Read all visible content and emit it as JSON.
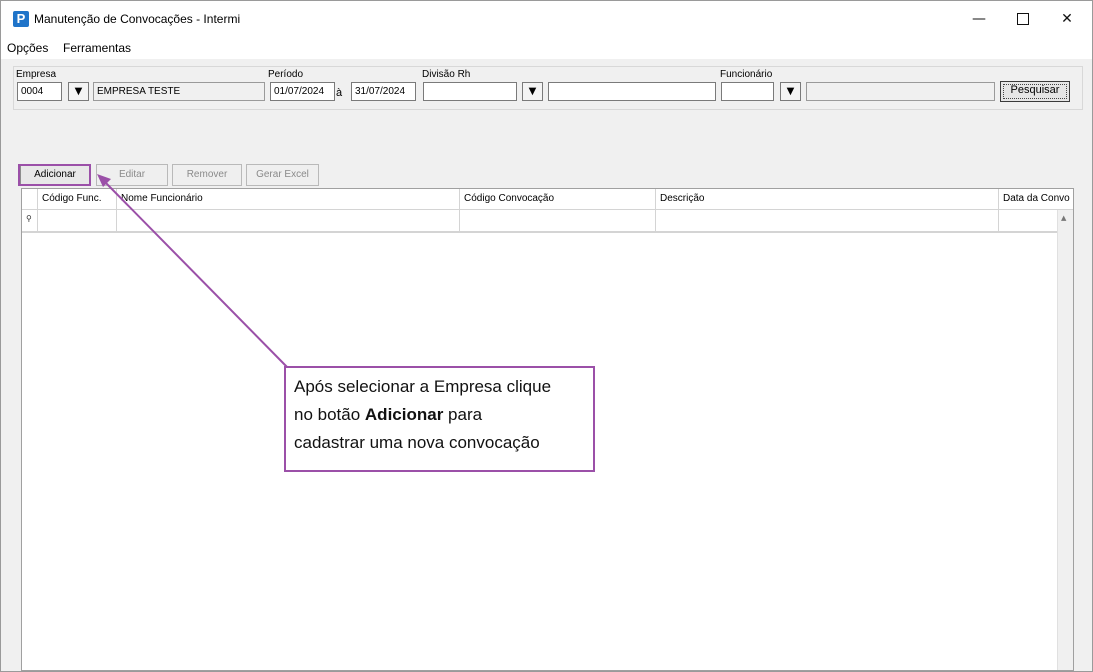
{
  "window": {
    "title": "Manutenção de Convocações - Intermi",
    "app_icon_glyph": "P",
    "minimize_glyph": "—",
    "close_glyph": "✕"
  },
  "menu": {
    "items": [
      "Opções",
      "Ferramentas"
    ]
  },
  "filters": {
    "empresa_label": "Empresa",
    "empresa_code": "0004",
    "empresa_name": "EMPRESA TESTE",
    "periodo_label": "Período",
    "periodo_start": "01/07/2024",
    "periodo_sep": "à",
    "periodo_end": "31/07/2024",
    "divisao_label": "Divisão Rh",
    "divisao_code": "",
    "divisao_name": "",
    "funcionario_label": "Funcionário",
    "funcionario_code": "",
    "funcionario_name": "",
    "dropdown_glyph": "▼",
    "search_label": "Pesquisar"
  },
  "toolbar": {
    "add_label": "Adicionar",
    "edit_label": "Editar",
    "remove_label": "Remover",
    "excel_label": "Gerar Excel"
  },
  "grid": {
    "columns": [
      "Código Func.",
      "Nome Funcionário",
      "Código Convocação",
      "Descrição",
      "Data da Convo"
    ],
    "filter_row_glyph": "⚲",
    "rows": []
  },
  "callout": {
    "line1": "Após selecionar a Empresa clique",
    "line2_pre": "no botão ",
    "line2_bold": "Adicionar",
    "line2_post": " para",
    "line3": "cadastrar uma nova convocação"
  },
  "colors": {
    "accent": "#9b50a8",
    "app_icon": "#1f74c9"
  }
}
